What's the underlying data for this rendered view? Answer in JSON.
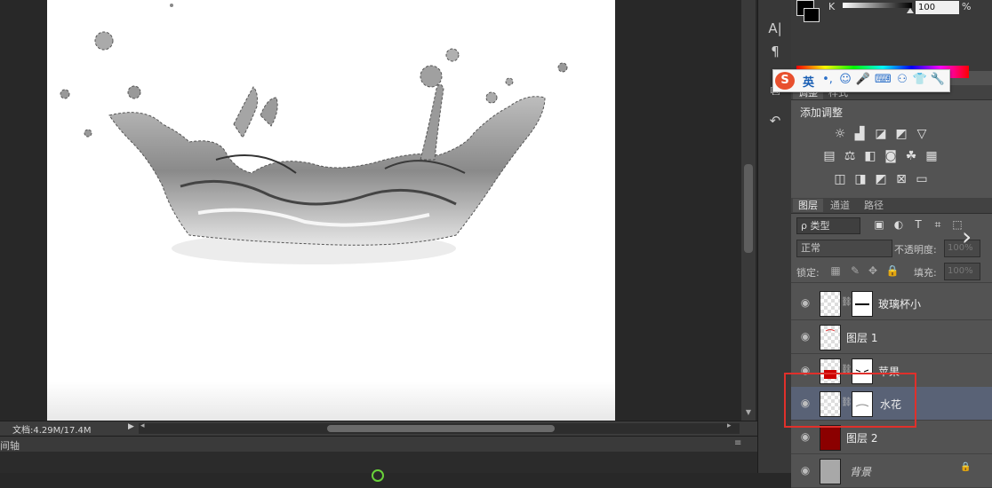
{
  "status": {
    "doc_info": "文档:4.29M/17.4M"
  },
  "timeline": {
    "label": "间轴"
  },
  "color": {
    "channel": "K",
    "value": "100",
    "unit": "%",
    "fg": "#000000",
    "bg": "#000000"
  },
  "ime": {
    "logo": "S",
    "lang": "英",
    "icons": [
      "punct-icon",
      "smiley-icon",
      "mic-icon",
      "keyboard-icon",
      "user-icon",
      "shirt-icon",
      "wrench-icon"
    ]
  },
  "adjustments": {
    "tabs": [
      "调整",
      "样式"
    ],
    "title": "添加调整",
    "icons": [
      [
        "brightness-icon",
        "levels-icon",
        "curves-icon",
        "exposure-icon",
        "vibrance-icon"
      ],
      [
        "hue-icon",
        "balance-icon",
        "bw-icon",
        "photo-filter-icon",
        "mixer-icon",
        "lookup-icon"
      ],
      [
        "invert-icon",
        "posterize-icon",
        "threshold-icon",
        "selective-color-icon",
        "gradient-map-icon"
      ]
    ]
  },
  "layers_panel": {
    "tabs": [
      "图层",
      "通道",
      "路径"
    ],
    "filter": "ρ 类型",
    "blend_mode": "正常",
    "opacity_label": "不透明度:",
    "opacity_value": "100%",
    "lock_label": "锁定:",
    "fill_label": "填充:",
    "fill_value": "100%",
    "layers": [
      {
        "name": "玻璃杯小",
        "has_mask": true,
        "selected": false,
        "visible": true
      },
      {
        "name": "图层 1",
        "has_mask": false,
        "selected": false,
        "visible": true
      },
      {
        "name": "苹果",
        "has_mask": true,
        "selected": false,
        "visible": true
      },
      {
        "name": "水花",
        "has_mask": true,
        "selected": true,
        "visible": true
      },
      {
        "name": "图层 2",
        "has_mask": false,
        "selected": false,
        "visible": true,
        "thumb_color": "#8b0000"
      },
      {
        "name": "背景",
        "has_mask": false,
        "selected": false,
        "visible": true,
        "locked": true,
        "thumb_color": "#a8a8a8"
      }
    ]
  },
  "accent": {
    "highlight": "#e0302b",
    "selected_row": "#596276"
  }
}
